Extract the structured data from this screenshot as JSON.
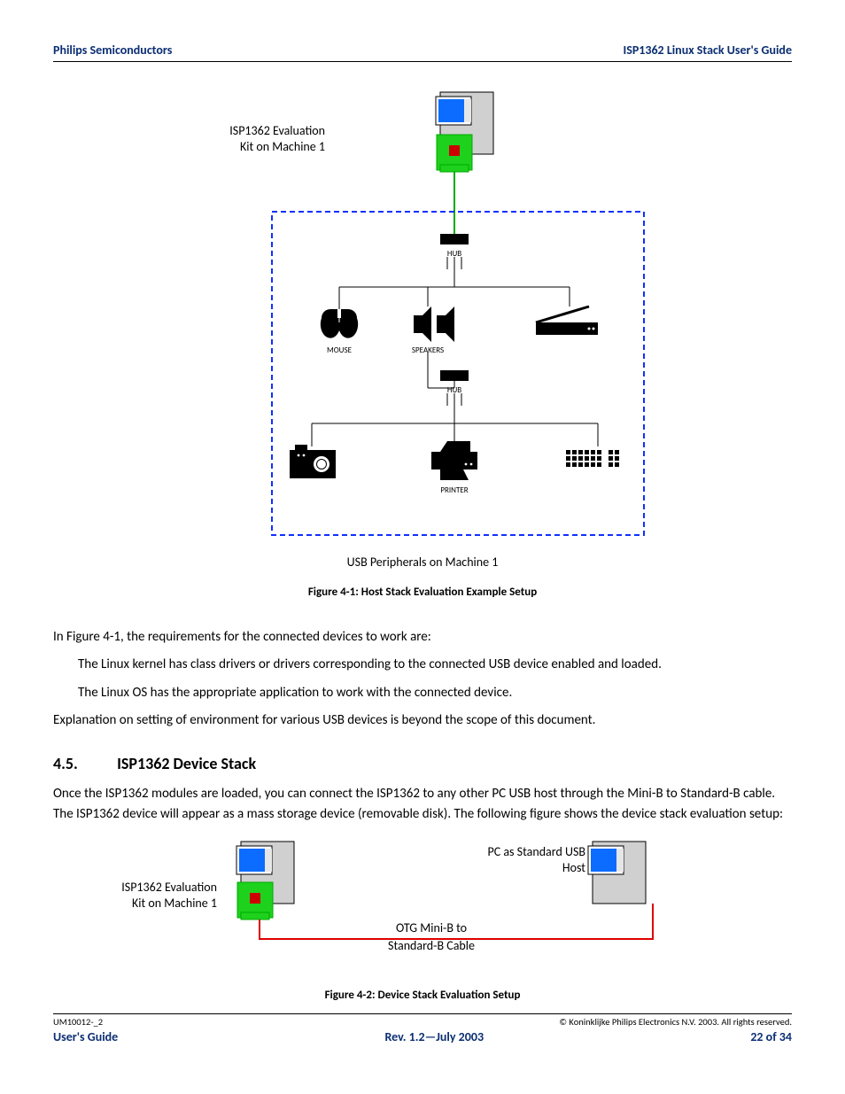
{
  "header": {
    "left": "Philips Semiconductors",
    "right": "ISP1362 Linux Stack User's Guide"
  },
  "figure1": {
    "label_kit": "ISP1362 Evaluation Kit on Machine 1",
    "hub1": "HUB",
    "mouse": "MOUSE",
    "speakers": "SPEAKERS",
    "hub2": "HUB",
    "printer": "PRINTER",
    "caption": "USB Peripherals on Machine 1",
    "title": "Figure 4-1: Host Stack Evaluation Example Setup"
  },
  "para1": "In Figure 4-1, the requirements for the connected devices to work are:",
  "bullet1": "The Linux kernel has class drivers or drivers corresponding to the connected USB device enabled and loaded.",
  "bullet2": "The Linux OS has the appropriate application to work with the connected device.",
  "para2": "Explanation on setting of environment for various USB devices is beyond the scope of this document.",
  "section": {
    "num": "4.5.",
    "title": "ISP1362 Device Stack"
  },
  "para3": "Once the ISP1362 modules are loaded, you can connect the ISP1362 to any other PC USB host through the Mini-B to Standard-B cable. The ISP1362 device will appear as a mass storage device (removable disk). The following figure shows the device stack evaluation setup:",
  "figure2": {
    "label_kit": "ISP1362 Evaluation Kit on Machine 1",
    "label_host": "PC as Standard USB Host",
    "cable1": "OTG Mini-B to",
    "cable2": "Standard-B Cable",
    "title": "Figure 4-2: Device Stack Evaluation Setup"
  },
  "footer": {
    "doc_id": "UM10012-_2",
    "copyright": "© Koninklijke Philips Electronics N.V. 2003. All rights reserved.",
    "left": "User's Guide",
    "center": "Rev. 1.2—July 2003",
    "right": "22 of 34"
  }
}
